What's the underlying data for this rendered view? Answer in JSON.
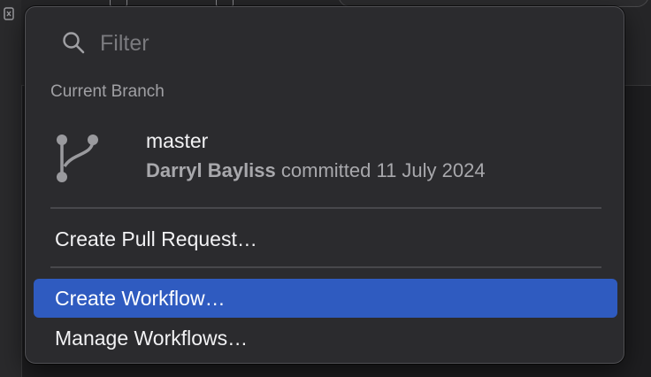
{
  "filter": {
    "placeholder": "Filter"
  },
  "current_branch": {
    "section_label": "Current Branch",
    "name": "master",
    "author": "Darryl Bayliss",
    "commit_text": "committed 11 July 2024"
  },
  "menu": {
    "items": [
      {
        "label": "Create Pull Request…",
        "highlighted": false
      },
      {
        "label": "Create Workflow…",
        "highlighted": true
      },
      {
        "label": "Manage Workflows…",
        "highlighted": false
      }
    ]
  },
  "colors": {
    "popover_bg": "#2b2b2e",
    "highlight": "#2f5bc0",
    "text_primary": "#f2f2f4",
    "text_secondary": "#a8a8ac"
  },
  "icons": {
    "search": "search-icon",
    "branch": "branch-icon"
  }
}
